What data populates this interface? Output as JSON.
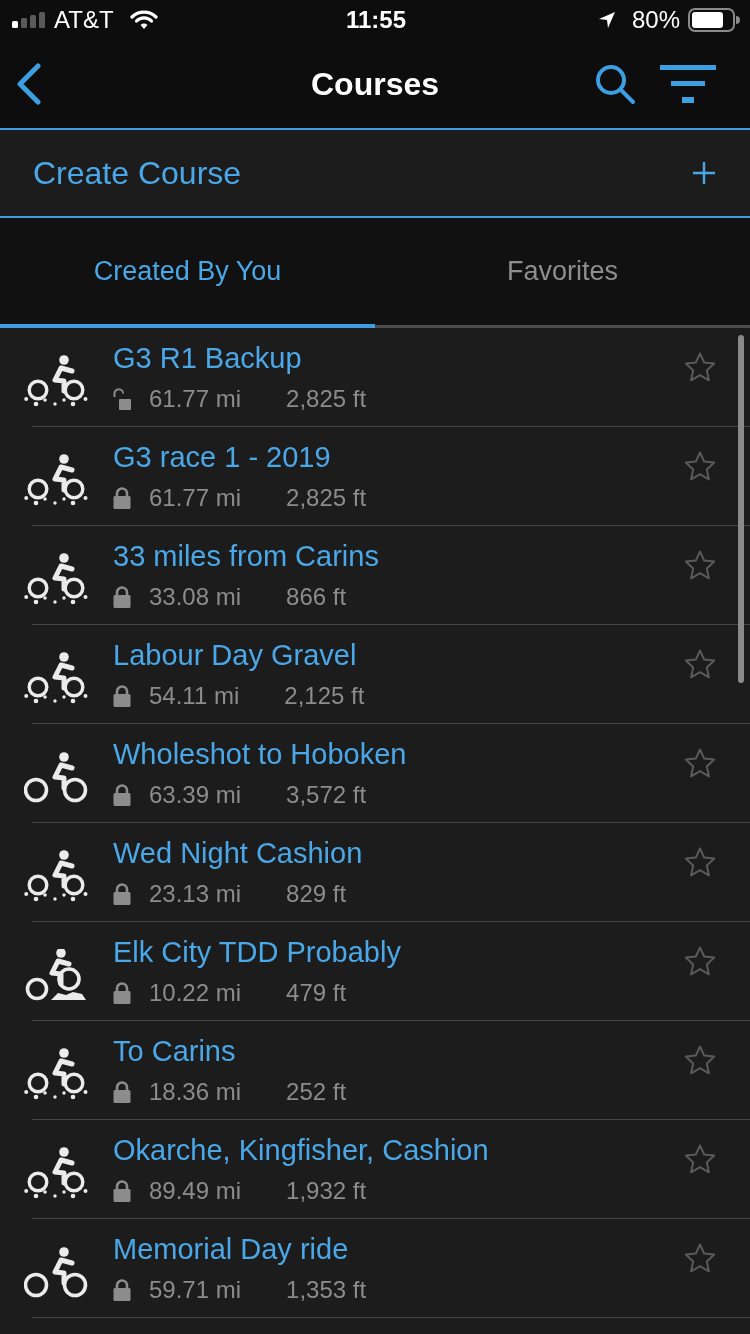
{
  "status_bar": {
    "carrier": "AT&T",
    "time": "11:55",
    "battery": "80%"
  },
  "nav": {
    "title": "Courses"
  },
  "create": {
    "label": "Create Course"
  },
  "tabs": [
    {
      "label": "Created By You",
      "selected": true
    },
    {
      "label": "Favorites",
      "selected": false
    }
  ],
  "courses": [
    {
      "kind": "gravel",
      "name": "G3 R1 Backup",
      "locked": false,
      "distance": "61.77 mi",
      "elevation": "2,825 ft",
      "favorite": false
    },
    {
      "kind": "gravel",
      "name": "G3 race 1 - 2019",
      "locked": true,
      "distance": "61.77 mi",
      "elevation": "2,825 ft",
      "favorite": false
    },
    {
      "kind": "gravel",
      "name": "33 miles from Carins",
      "locked": true,
      "distance": "33.08 mi",
      "elevation": "866 ft",
      "favorite": false
    },
    {
      "kind": "gravel",
      "name": "Labour Day Gravel",
      "locked": true,
      "distance": "54.11 mi",
      "elevation": "2,125 ft",
      "favorite": false
    },
    {
      "kind": "road",
      "name": "Wholeshot to Hoboken",
      "locked": true,
      "distance": "63.39 mi",
      "elevation": "3,572 ft",
      "favorite": false
    },
    {
      "kind": "gravel",
      "name": "Wed Night Cashion",
      "locked": true,
      "distance": "23.13 mi",
      "elevation": "829 ft",
      "favorite": false
    },
    {
      "kind": "mountain",
      "name": "Elk City TDD Probably",
      "locked": true,
      "distance": "10.22 mi",
      "elevation": "479 ft",
      "favorite": false
    },
    {
      "kind": "gravel",
      "name": "To Carins",
      "locked": true,
      "distance": "18.36 mi",
      "elevation": "252 ft",
      "favorite": false
    },
    {
      "kind": "gravel",
      "name": "Okarche, Kingfisher, Cashion",
      "locked": true,
      "distance": "89.49 mi",
      "elevation": "1,932 ft",
      "favorite": false
    },
    {
      "kind": "road",
      "name": "Memorial Day ride",
      "locked": true,
      "distance": "59.71 mi",
      "elevation": "1,353 ft",
      "favorite": false
    }
  ]
}
